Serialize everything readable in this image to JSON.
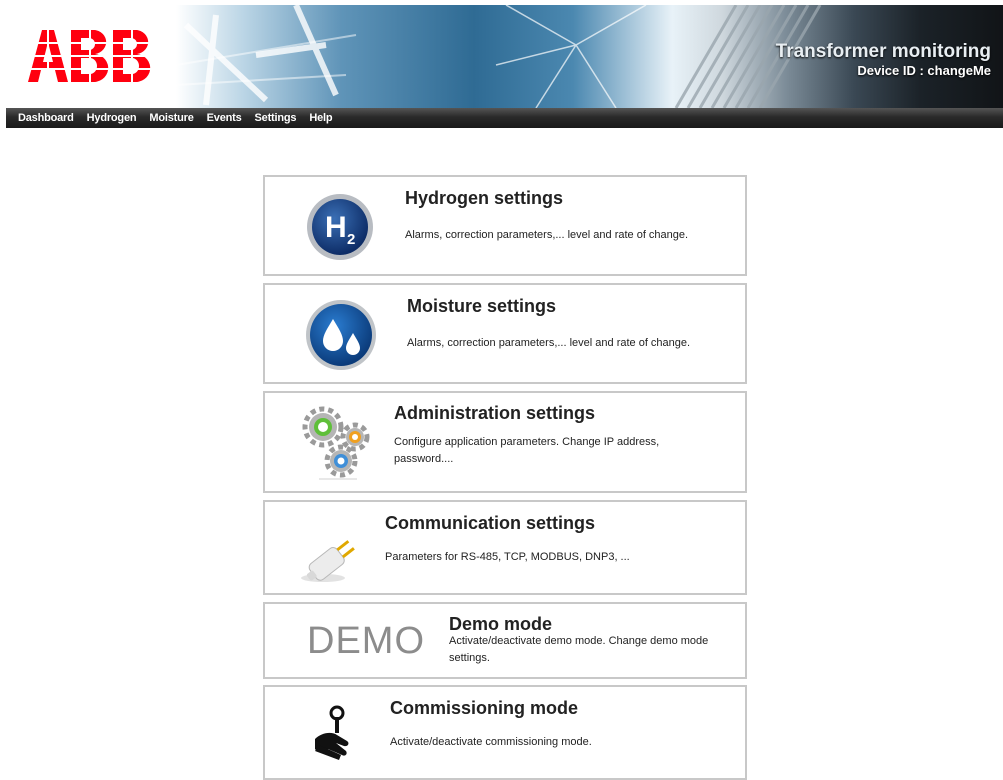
{
  "header": {
    "brand": "ABB",
    "title": "Transformer monitoring",
    "device_id": "Device ID : changeMe"
  },
  "nav": {
    "items": [
      "Dashboard",
      "Hydrogen",
      "Moisture",
      "Events",
      "Settings",
      "Help"
    ]
  },
  "cards": [
    {
      "title": "Hydrogen settings",
      "desc": "Alarms, correction parameters,... level and rate of change.",
      "icon": "hydrogen-h2-icon"
    },
    {
      "title": "Moisture settings",
      "desc": "Alarms, correction parameters,... level and rate of change.",
      "icon": "water-drops-icon"
    },
    {
      "title": "Administration settings",
      "desc": "Configure application parameters. Change IP address, password....",
      "icon": "gears-icon"
    },
    {
      "title": "Communication settings",
      "desc": "Parameters for RS-485, TCP, MODBUS, DNP3, ...",
      "icon": "plug-icon"
    },
    {
      "title": "Demo mode",
      "desc": "Activate/deactivate demo mode. Change demo mode settings.",
      "icon": "demo-text-icon",
      "icon_text": "DEMO"
    },
    {
      "title": "Commissioning mode",
      "desc": "Activate/deactivate commissioning mode.",
      "icon": "hand-wrench-icon"
    }
  ],
  "colors": {
    "brand_red": "#ff000f",
    "nav_bg": "#2a2a2a",
    "card_border": "#c8c8c8"
  }
}
